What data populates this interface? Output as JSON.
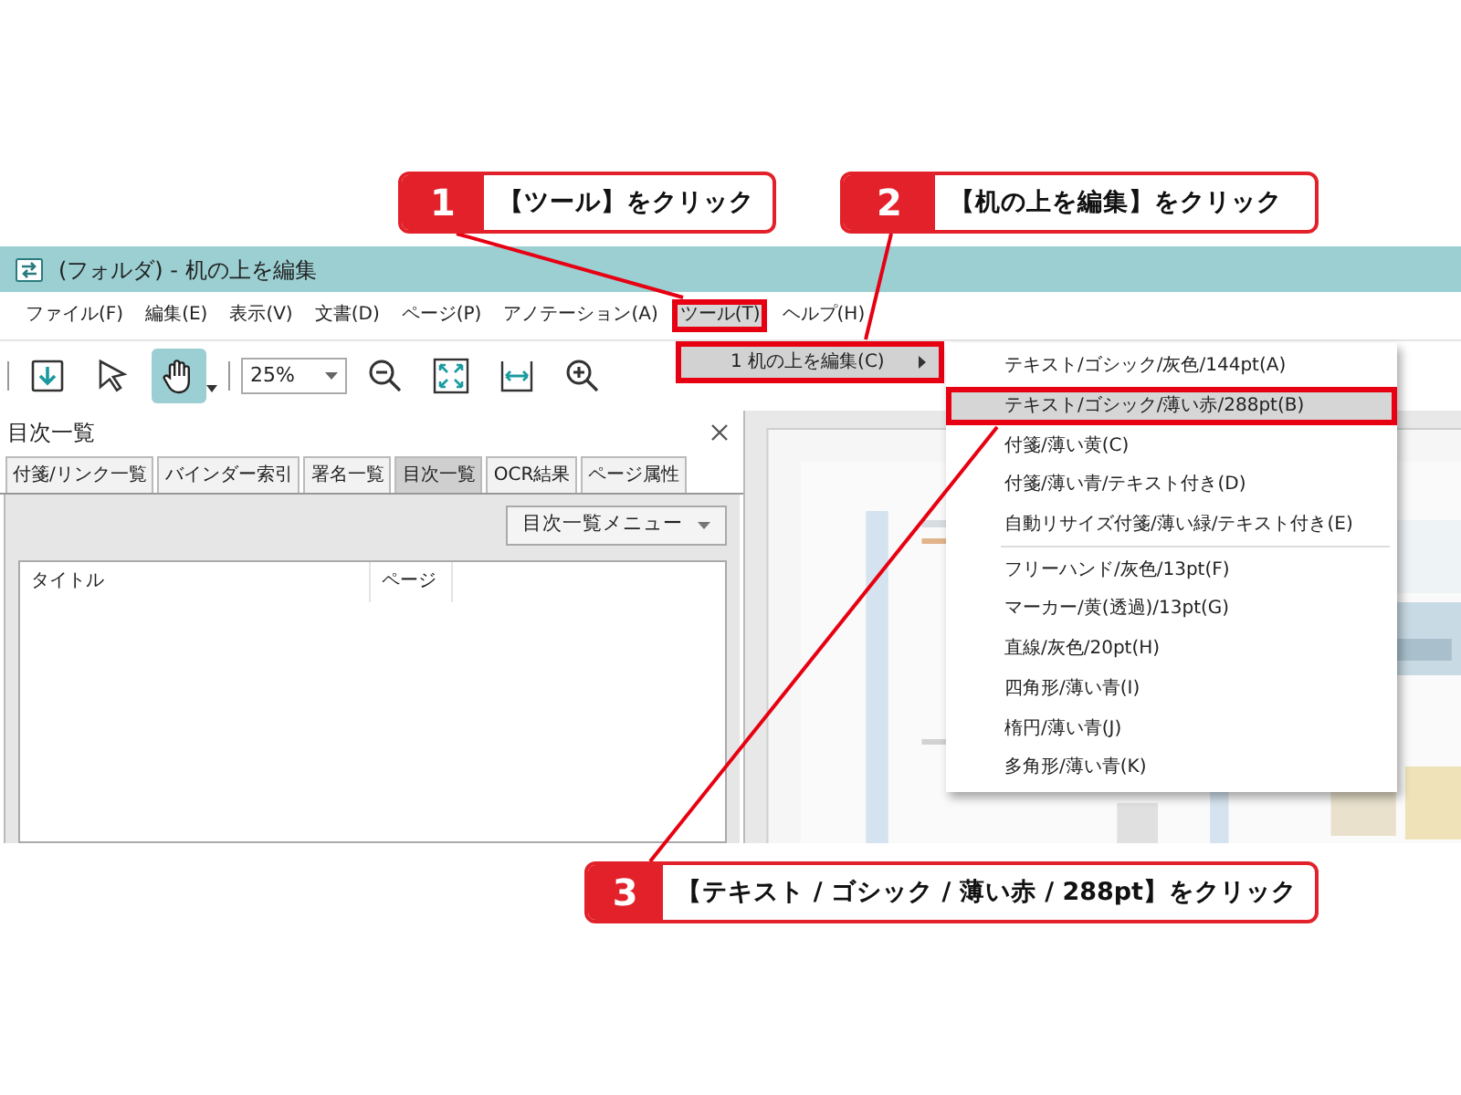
{
  "window": {
    "title": "(フォルダ) - 机の上を編集"
  },
  "menu_bar": [
    {
      "label": "ファイル(F)",
      "selected": false,
      "outlined": false
    },
    {
      "label": "編集(E)",
      "selected": false,
      "outlined": false
    },
    {
      "label": "表示(V)",
      "selected": false,
      "outlined": false
    },
    {
      "label": "文書(D)",
      "selected": false,
      "outlined": false
    },
    {
      "label": "ページ(P)",
      "selected": false,
      "outlined": false
    },
    {
      "label": "アノテーション(A)",
      "selected": false,
      "outlined": false
    },
    {
      "label": "ツール(T)",
      "selected": true,
      "outlined": true
    },
    {
      "label": "ヘルプ(H)",
      "selected": false,
      "outlined": false
    }
  ],
  "toolbar": {
    "zoom": "25%",
    "tools": [
      {
        "kind": "download",
        "selected": false
      },
      {
        "kind": "pointer",
        "selected": false
      },
      {
        "kind": "hand",
        "selected": true
      },
      {
        "kind": "zoom-out",
        "selected": false
      },
      {
        "kind": "fit-page",
        "selected": false
      },
      {
        "kind": "fit-width",
        "selected": false
      },
      {
        "kind": "zoom-in",
        "selected": false
      }
    ]
  },
  "submenu": {
    "items": [
      {
        "label": "1 机の上を編集(C)",
        "selected": true,
        "outlined": true
      }
    ]
  },
  "flyout": {
    "items": [
      {
        "kind": "item",
        "label": "テキスト/ゴシック/灰色/144pt(A)",
        "selected": false,
        "outlined": false
      },
      {
        "kind": "item",
        "label": "テキスト/ゴシック/薄い赤/288pt(B)",
        "selected": true,
        "outlined": true
      },
      {
        "kind": "item",
        "label": "付箋/薄い黄(C)",
        "selected": false,
        "outlined": false
      },
      {
        "kind": "item",
        "label": "付箋/薄い青/テキスト付き(D)",
        "selected": false,
        "outlined": false
      },
      {
        "kind": "item",
        "label": "自動リサイズ付箋/薄い緑/テキスト付き(E)",
        "selected": false,
        "outlined": false
      },
      {
        "kind": "separator"
      },
      {
        "kind": "item",
        "label": "フリーハンド/灰色/13pt(F)",
        "selected": false,
        "outlined": false
      },
      {
        "kind": "item",
        "label": "マーカー/黄(透過)/13pt(G)",
        "selected": false,
        "outlined": false
      },
      {
        "kind": "item",
        "label": "直線/灰色/20pt(H)",
        "selected": false,
        "outlined": false
      },
      {
        "kind": "item",
        "label": "四角形/薄い青(I)",
        "selected": false,
        "outlined": false
      },
      {
        "kind": "item",
        "label": "楕円/薄い青(J)",
        "selected": false,
        "outlined": false
      },
      {
        "kind": "item",
        "label": "多角形/薄い青(K)",
        "selected": false,
        "outlined": false
      }
    ]
  },
  "panel": {
    "title": "目次一覧",
    "tabs": [
      {
        "label": "付箋/リンク一覧",
        "selected": false
      },
      {
        "label": "バインダー索引",
        "selected": false
      },
      {
        "label": "署名一覧",
        "selected": false
      },
      {
        "label": "目次一覧",
        "selected": true
      },
      {
        "label": "OCR結果",
        "selected": false
      },
      {
        "label": "ページ属性",
        "selected": false
      }
    ],
    "menu_button": "目次一覧メニュー",
    "columns": [
      "タイトル",
      "ページ"
    ]
  },
  "callouts": [
    {
      "number": "1",
      "text": "【ツール】をクリック"
    },
    {
      "number": "2",
      "text": "【机の上を編集】をクリック"
    },
    {
      "number": "3",
      "text": "【テキスト / ゴシック / 薄い赤 / 288pt】をクリック"
    }
  ]
}
